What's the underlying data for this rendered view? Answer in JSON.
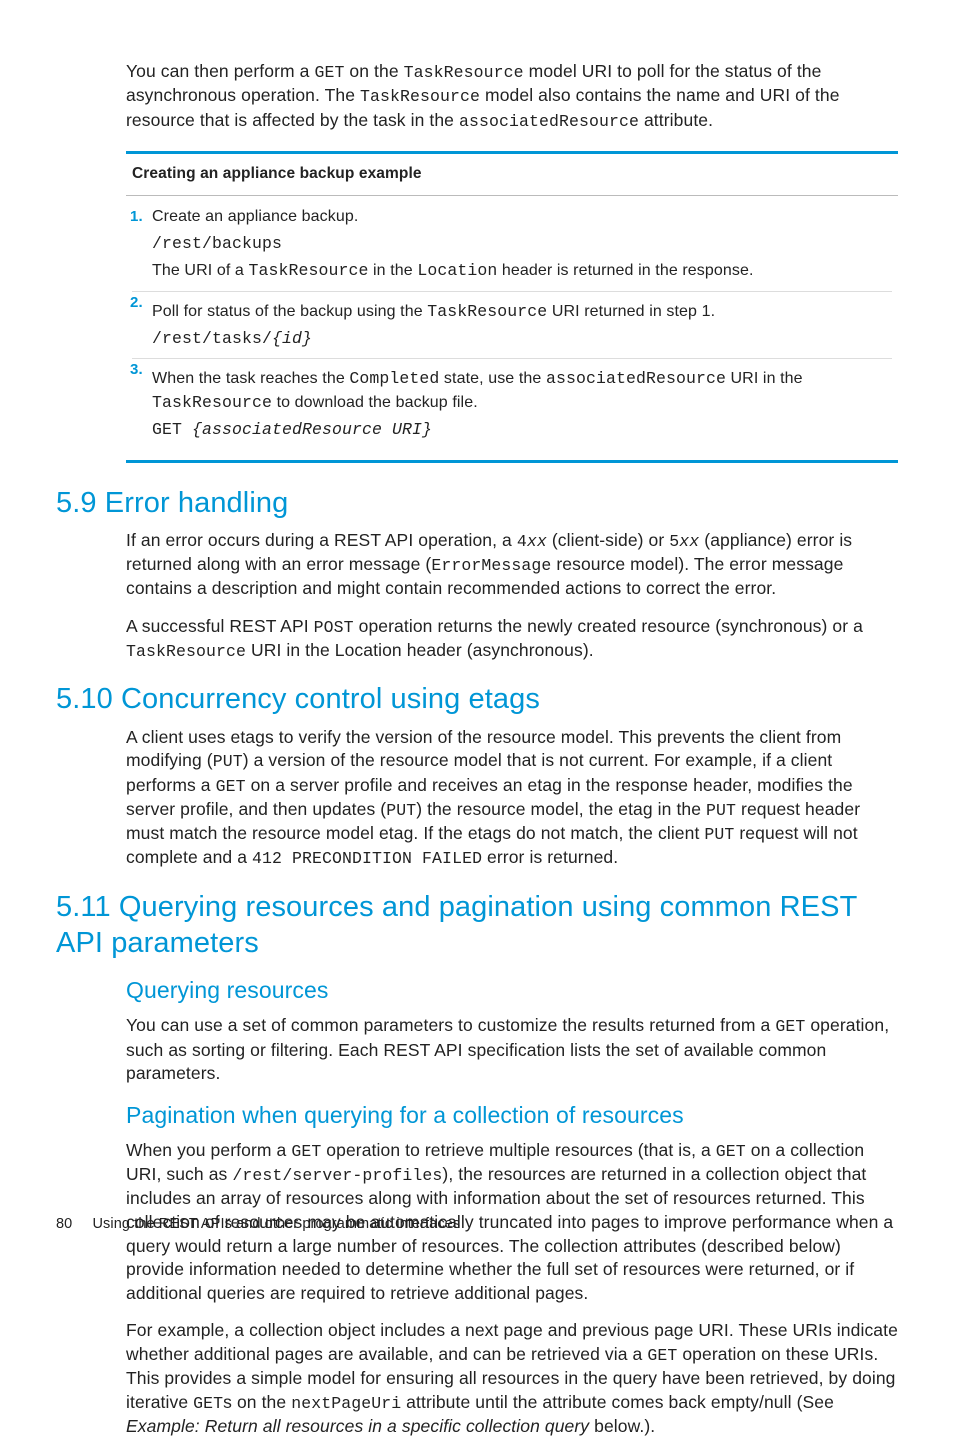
{
  "intro": {
    "p1_a": "You can then perform a ",
    "p1_b": " on the ",
    "p1_c": " model URI to poll for the status of the asynchronous operation. The ",
    "p1_d": " model also contains the name and URI of the resource that is affected by the task in the ",
    "p1_e": " attribute.",
    "code_get": "GET",
    "code_tr": "TaskResource",
    "code_ar": "associatedResource"
  },
  "example": {
    "title": "Creating an appliance backup example",
    "s1_a": "Create an appliance backup.",
    "s1_code": "/rest/backups",
    "s1_b_a": "The URI of a ",
    "s1_b_tr": "TaskResource",
    "s1_b_b": " in the ",
    "s1_b_loc": "Location",
    "s1_b_c": " header is returned in the response.",
    "s2_a": "Poll for status of the backup using the ",
    "s2_tr": "TaskResource",
    "s2_b": " URI returned in step 1.",
    "s2_code": "/rest/tasks/",
    "s2_code_i": "{id}",
    "s3_a": "When the task reaches the ",
    "s3_comp": "Completed",
    "s3_b": " state, use the ",
    "s3_ar": "associatedResource",
    "s3_c": " URI in the ",
    "s3_tr": "TaskResource",
    "s3_d": " to download the backup file.",
    "s3_code_a": "GET ",
    "s3_code_b": "{associatedResource URI}"
  },
  "sec59": {
    "heading": "5.9 Error handling",
    "p1_a": "If an error occurs during a REST API operation, a ",
    "p1_4": "4",
    "p1_xx1": "xx",
    "p1_b": " (client-side) or ",
    "p1_5": "5",
    "p1_xx2": "xx",
    "p1_c": " (appliance) error is returned along with an error message (",
    "p1_em": "ErrorMessage",
    "p1_d": " resource model). The error message contains a description and might contain recommended actions to correct the error.",
    "p2_a": "A successful REST API ",
    "p2_post": "POST",
    "p2_b": " operation returns the newly created resource (synchronous) or a ",
    "p2_tr": "TaskResource",
    "p2_c": " URI in the Location header (asynchronous)."
  },
  "sec510": {
    "heading": "5.10 Concurrency control using etags",
    "p1_a": "A client uses etags to verify the version of the resource model. This prevents the client from modifying (",
    "p1_put1": "PUT",
    "p1_b": ") a version of the resource model that is not current. For example, if a client performs a ",
    "p1_get": "GET",
    "p1_c": " on a server profile and receives an etag in the response header, modifies the server profile, and then updates (",
    "p1_put2": "PUT",
    "p1_d": ") the resource model, the etag in the ",
    "p1_put3": "PUT",
    "p1_e": " request header must match the resource model etag. If the etags do not match, the client ",
    "p1_put4": "PUT",
    "p1_f": " request will not complete and a ",
    "p1_412": "412 PRECONDITION FAILED",
    "p1_g": " error is returned."
  },
  "sec511": {
    "heading": "5.11 Querying resources and pagination using common REST API parameters",
    "sub1": "Querying resources",
    "sub1_p_a": "You can use a set of common parameters to customize the results returned from a ",
    "sub1_p_get": "GET",
    "sub1_p_b": " operation, such as sorting or filtering. Each REST API specification lists the set of available common parameters.",
    "sub2": "Pagination when querying for a collection of resources",
    "sub2_p1_a": "When you perform a ",
    "sub2_p1_get1": "GET",
    "sub2_p1_b": " operation to retrieve multiple resources (that is, a ",
    "sub2_p1_get2": "GET",
    "sub2_p1_c": " on a collection URI, such as ",
    "sub2_p1_uri": "/rest/server-profiles",
    "sub2_p1_d": "), the resources are returned in a collection object that includes an array of resources along with information about the set of resources returned. This collection of resources may be automatically truncated into pages to improve performance when a query would return a large number of resources. The collection attributes (described below) provide information needed to determine whether the full set of resources were returned, or if additional queries are required to retrieve additional pages.",
    "sub2_p2_a": "For example, a collection object includes a next page and previous page URI. These URIs indicate whether additional pages are available, and can be retrieved via a ",
    "sub2_p2_get": "GET",
    "sub2_p2_b": " operation on these URIs. This provides a simple model for ensuring all resources in the query have been retrieved, by doing iterative ",
    "sub2_p2_gets": "GET",
    "sub2_p2_c": "s on the ",
    "sub2_p2_npu": "nextPageUri",
    "sub2_p2_d": " attribute until the attribute comes back empty/null (See ",
    "sub2_p2_e": "Example: Return all resources in a specific collection query",
    "sub2_p2_f": " below.)."
  },
  "footer": {
    "page": "80",
    "text": "Using the REST APIs and other programmatic interfaces"
  }
}
